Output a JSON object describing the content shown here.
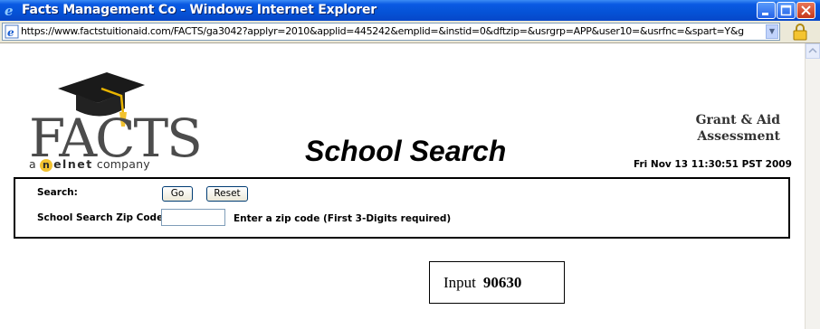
{
  "window": {
    "title": "Facts Management Co - Windows Internet Explorer",
    "icons": {
      "app": "internet-explorer-icon",
      "minimize": "minimize-icon",
      "maximize": "maximize-icon",
      "close": "close-icon"
    }
  },
  "address_bar": {
    "url": "https://www.factstuitionaid.com/FACTS/ga3042?applyr=2010&applid=445242&emplid=&instid=0&dftzip=&usrgrp=APP&user10=&usrfnc=&spart=Y&g",
    "icons": {
      "page": "page-icon",
      "dropdown": "chevron-down-icon",
      "security": "lock-icon"
    }
  },
  "header": {
    "logo": {
      "wordmark": "FACTS",
      "tagline_prefix": "a",
      "tagline_brand_initial": "n",
      "tagline_brand_rest": "elnet",
      "tagline_suffix": "company",
      "icon": "graduation-cap-icon"
    },
    "page_title": "School Search",
    "product_name": "Grant & Aid Assessment",
    "timestamp": "Fri Nov 13 11:30:51 PST 2009"
  },
  "search_form": {
    "search_label": "Search:",
    "go_label": "Go",
    "reset_label": "Reset",
    "zip_label": "School Search Zip Code:",
    "zip_value": "",
    "zip_hint": "Enter a zip code (First 3-Digits required)"
  },
  "annotation": {
    "label": "Input",
    "value": "90630"
  },
  "colors": {
    "titlebar": "#0552d6",
    "logo_accent": "#f2c230",
    "logo_gray": "#4c4c4c"
  }
}
